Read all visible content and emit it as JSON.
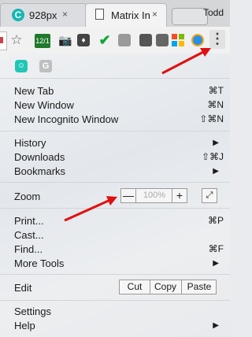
{
  "tabs": [
    {
      "title": "928px",
      "close": "×",
      "favicon": "C"
    },
    {
      "title": "Matrix In",
      "close": "×"
    }
  ],
  "profile": "Todd",
  "toolbar": {
    "calendar_badge": "12/1",
    "kebab": "⋮"
  },
  "extensions": {
    "g_label": "G"
  },
  "menu": {
    "new_tab": {
      "label": "New Tab",
      "shortcut": "⌘T"
    },
    "new_window": {
      "label": "New Window",
      "shortcut": "⌘N"
    },
    "incognito": {
      "label": "New Incognito Window",
      "shortcut": "⇧⌘N"
    },
    "history": {
      "label": "History",
      "arrow": "▶"
    },
    "downloads": {
      "label": "Downloads",
      "shortcut": "⇧⌘J"
    },
    "bookmarks": {
      "label": "Bookmarks",
      "arrow": "▶"
    },
    "zoom": {
      "label": "Zoom",
      "minus": "—",
      "value": "100%",
      "plus": "+",
      "fullscreen": "⤢"
    },
    "print": {
      "label": "Print...",
      "shortcut": "⌘P"
    },
    "cast": {
      "label": "Cast..."
    },
    "find": {
      "label": "Find...",
      "shortcut": "⌘F"
    },
    "more_tools": {
      "label": "More Tools",
      "arrow": "▶"
    },
    "edit": {
      "label": "Edit",
      "cut": "Cut",
      "copy": "Copy",
      "paste": "Paste"
    },
    "settings": {
      "label": "Settings"
    },
    "help": {
      "label": "Help",
      "arrow": "▶"
    }
  },
  "colors": {
    "annotation_arrow": "#e01010",
    "accent_teal": "#15b7b2"
  }
}
